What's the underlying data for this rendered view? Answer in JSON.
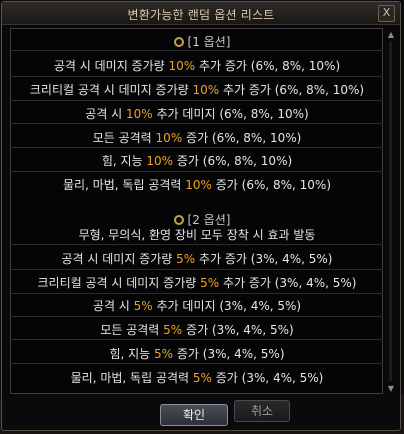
{
  "window": {
    "title": "변환가능한 랜덤 옵션 리스트",
    "close_label": "X"
  },
  "section1": {
    "header": "[1 옵션]",
    "lines": [
      {
        "pre": "공격 시 데미지 증가량 ",
        "hl": "10%",
        "post": " 추가 증가 (6%, 8%, 10%)"
      },
      {
        "pre": "크리티컬 공격 시 데미지 증가량 ",
        "hl": "10%",
        "post": " 추가 증가 (6%, 8%, 10%)"
      },
      {
        "pre": "공격 시 ",
        "hl": "10%",
        "post": " 추가 데미지 (6%, 8%, 10%)"
      },
      {
        "pre": "모든 공격력 ",
        "hl": "10%",
        "post": " 증가 (6%, 8%, 10%)"
      },
      {
        "pre": "힘, 지능 ",
        "hl": "10%",
        "post": " 증가 (6%, 8%, 10%)"
      },
      {
        "pre": "물리, 마법, 독립 공격력 ",
        "hl": "10%",
        "post": " 증가 (6%, 8%, 10%)"
      }
    ]
  },
  "section2": {
    "header": "[2 옵션]",
    "intro": "무형, 무의식, 환영 장비 모두 장착 시 효과 발동",
    "lines": [
      {
        "pre": "공격 시 데미지 증가량 ",
        "hl": "5%",
        "post": " 추가 증가 (3%, 4%, 5%)"
      },
      {
        "pre": "크리티컬 공격 시 데미지 증가량 ",
        "hl": "5%",
        "post": " 추가 증가 (3%, 4%, 5%)"
      },
      {
        "pre": "공격 시 ",
        "hl": "5%",
        "post": " 추가 데미지 (3%, 4%, 5%)"
      },
      {
        "pre": "모든 공격력 ",
        "hl": "5%",
        "post": " 증가 (3%, 4%, 5%)"
      },
      {
        "pre": "힘, 지능 ",
        "hl": "5%",
        "post": " 증가 (3%, 4%, 5%)"
      },
      {
        "pre": "물리, 마법, 독립 공격력 ",
        "hl": "5%",
        "post": " 증가 (3%, 4%, 5%)"
      }
    ]
  },
  "buttons": {
    "ok": "확인",
    "cancel": "취소"
  },
  "colors": {
    "highlight": "#f2a11d",
    "text": "#e6e6e6",
    "icon": "#c9a23a"
  }
}
